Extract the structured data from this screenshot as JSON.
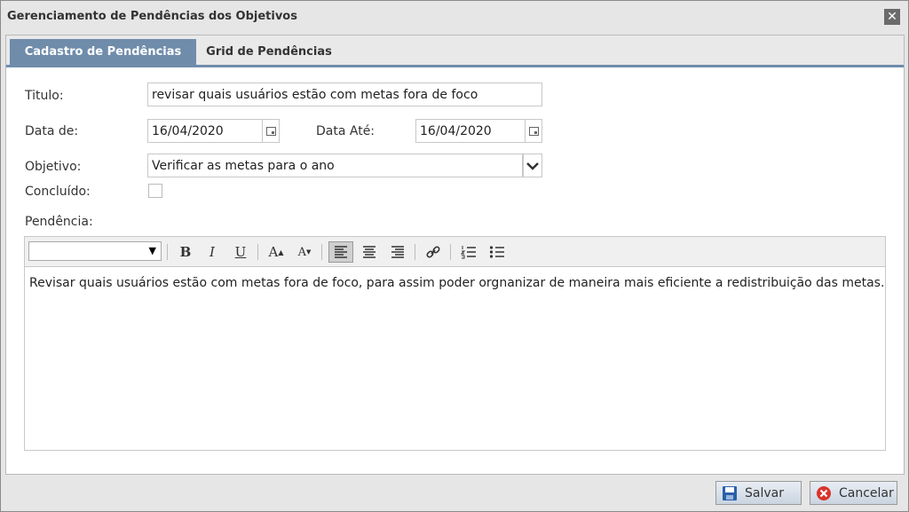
{
  "dialog": {
    "title": "Gerenciamento de Pendências dos Objetivos",
    "close_icon": "close-icon"
  },
  "tabs": [
    {
      "label": "Cadastro de Pendências",
      "active": true
    },
    {
      "label": "Grid de Pendências",
      "active": false
    }
  ],
  "form": {
    "titulo_label": "Titulo:",
    "titulo_value": "revisar quais usuários estão com metas fora de foco",
    "data_de_label": "Data de:",
    "data_de_value": "16/04/2020",
    "data_ate_label": "Data Até:",
    "data_ate_value": "16/04/2020",
    "objetivo_label": "Objetivo:",
    "objetivo_value": "Verificar as metas para o ano",
    "concluido_label": "Concluído:",
    "concluido_checked": false,
    "pendencia_label": "Pendência:"
  },
  "editor": {
    "font_value": "",
    "toolbar": {
      "bold": "B",
      "italic": "I",
      "underline": "U",
      "grow_font": "A",
      "shrink_font": "A"
    },
    "content": "Revisar quais usuários estão com metas fora de foco, para assim poder orgnanizar de maneira mais eficiente a redistribuição das metas."
  },
  "footer": {
    "save_label": "Salvar",
    "cancel_label": "Cancelar"
  },
  "colors": {
    "tab_active": "#6f8cab",
    "cancel_icon": "#d9342b",
    "save_icon": "#2a5fa8"
  }
}
